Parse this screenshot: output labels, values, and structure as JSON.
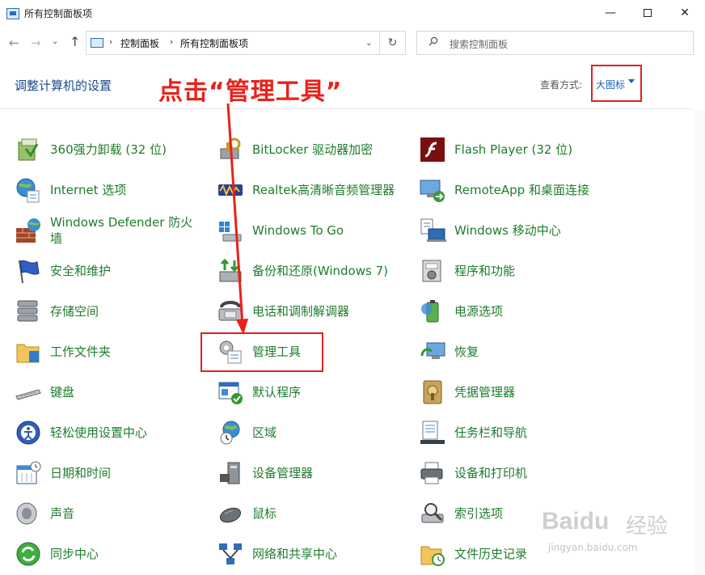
{
  "window": {
    "title": "所有控制面板项",
    "minimize": "—",
    "close": "✕"
  },
  "nav": {
    "back": "←",
    "forward": "→",
    "recent": "⌄",
    "up": "↑",
    "breadcrumb": [
      "控制面板",
      "所有控制面板项"
    ],
    "separator": "›",
    "refresh": "↻",
    "search_placeholder": "搜索控制面板"
  },
  "header": {
    "title": "调整计算机的设置",
    "view_by_label": "查看方式:",
    "view_by_value": "大图标"
  },
  "annotation": "点击“管理工具”",
  "items": [
    {
      "label": "360强力卸载 (32 位)",
      "icon": "uninstall-icon"
    },
    {
      "label": "BitLocker 驱动器加密",
      "icon": "bitlocker-icon"
    },
    {
      "label": "Flash Player (32 位)",
      "icon": "flash-icon"
    },
    {
      "label": "Internet 选项",
      "icon": "internet-options-icon"
    },
    {
      "label": "Realtek高清晰音频管理器",
      "icon": "realtek-audio-icon"
    },
    {
      "label": "RemoteApp 和桌面连接",
      "icon": "remoteapp-icon"
    },
    {
      "label": "Windows Defender 防火墙",
      "icon": "firewall-icon"
    },
    {
      "label": "Windows To Go",
      "icon": "windows-to-go-icon"
    },
    {
      "label": "Windows 移动中心",
      "icon": "mobility-center-icon"
    },
    {
      "label": "安全和维护",
      "icon": "security-flag-icon"
    },
    {
      "label": "备份和还原(Windows 7)",
      "icon": "backup-icon"
    },
    {
      "label": "程序和功能",
      "icon": "programs-icon"
    },
    {
      "label": "存储空间",
      "icon": "storage-icon"
    },
    {
      "label": "电话和调制解调器",
      "icon": "phone-modem-icon"
    },
    {
      "label": "电源选项",
      "icon": "power-options-icon"
    },
    {
      "label": "工作文件夹",
      "icon": "work-folders-icon"
    },
    {
      "label": "管理工具",
      "icon": "admin-tools-icon"
    },
    {
      "label": "恢复",
      "icon": "recovery-icon"
    },
    {
      "label": "键盘",
      "icon": "keyboard-icon"
    },
    {
      "label": "默认程序",
      "icon": "default-programs-icon"
    },
    {
      "label": "凭据管理器",
      "icon": "credential-manager-icon"
    },
    {
      "label": "轻松使用设置中心",
      "icon": "ease-of-access-icon"
    },
    {
      "label": "区域",
      "icon": "region-icon"
    },
    {
      "label": "任务栏和导航",
      "icon": "taskbar-icon"
    },
    {
      "label": "日期和时间",
      "icon": "date-time-icon"
    },
    {
      "label": "设备管理器",
      "icon": "device-manager-icon"
    },
    {
      "label": "设备和打印机",
      "icon": "printer-icon"
    },
    {
      "label": "声音",
      "icon": "sound-icon"
    },
    {
      "label": "鼠标",
      "icon": "mouse-icon"
    },
    {
      "label": "索引选项",
      "icon": "indexing-icon"
    },
    {
      "label": "同步中心",
      "icon": "sync-center-icon"
    },
    {
      "label": "网络和共享中心",
      "icon": "network-icon"
    },
    {
      "label": "文件历史记录",
      "icon": "file-history-icon"
    }
  ],
  "watermark": {
    "logo": "Baidu",
    "text": "经验",
    "url": "jingyan.baidu.com"
  },
  "colors": {
    "link_green": "#1e7d2c",
    "link_blue": "#1a5fb4",
    "annotation_red": "#e8221b"
  }
}
